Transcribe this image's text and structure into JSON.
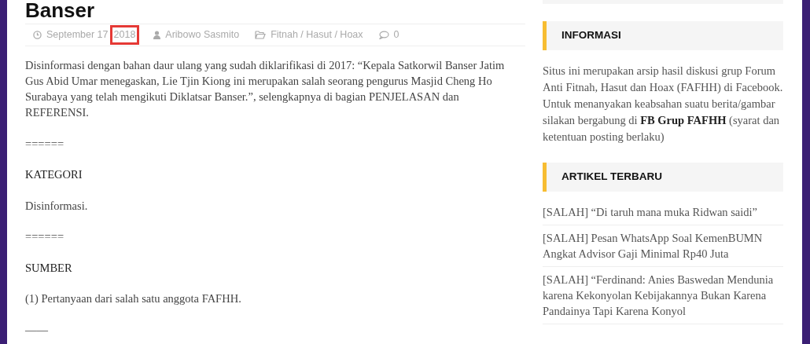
{
  "article": {
    "title": "Banser",
    "meta": {
      "date": "September 17",
      "date_highlight": {
        "text": "2018",
        "highlighted": true
      },
      "author": "Aribowo Sasmito",
      "category": "Fitnah / Hasut / Hoax",
      "comments": "0"
    },
    "paragraphs": [
      {
        "kind": "text",
        "text": "Disinformasi dengan bahan daur ulang yang sudah diklarifikasi di 2017: “Kepala Satkorwil Banser Jatim Gus Abid Umar menegaskan, Lie Tjin Kiong ini merupakan salah seorang pengurus Masjid Cheng Ho Surabaya yang telah mengikuti Diklatsar Banser.”, selengkapnya di bagian PENJELASAN dan REFERENSI."
      },
      {
        "kind": "text",
        "text": "======"
      },
      {
        "kind": "heading",
        "text": "KATEGORI"
      },
      {
        "kind": "text",
        "text": "Disinformasi."
      },
      {
        "kind": "text",
        "text": "======"
      },
      {
        "kind": "heading",
        "text": "SUMBER"
      },
      {
        "kind": "text",
        "text": "(1) Pertanyaan dari salah satu anggota FAFHH."
      },
      {
        "kind": "text",
        "text": "——"
      }
    ]
  },
  "sidebar": {
    "widgets": [
      {
        "kind": "text",
        "title": "INFORMASI",
        "text": "Situs ini merupakan arsip hasil diskusi grup Forum Anti Fitnah, Hasut dan Hoax (FAFHH) di Facebook. Untuk menanyakan keabsahan suatu berita/gambar silakan bergabung di **FB Grup FAFHH** (syarat dan ketentuan posting berlaku)"
      },
      {
        "kind": "list",
        "title": "ARTIKEL TERBARU",
        "items": [
          "[SALAH] “Di taruh mana muka Ridwan saidi”",
          "[SALAH] Pesan WhatsApp Soal KemenBUMN Angkat Advisor Gaji Minimal Rp40 Juta",
          "[SALAH] “Ferdinand: Anies Baswedan Mendunia karena Kekonyolan Kebijakannya Bukan Karena Pandainya Tapi Karena Konyol"
        ]
      }
    ]
  }
}
